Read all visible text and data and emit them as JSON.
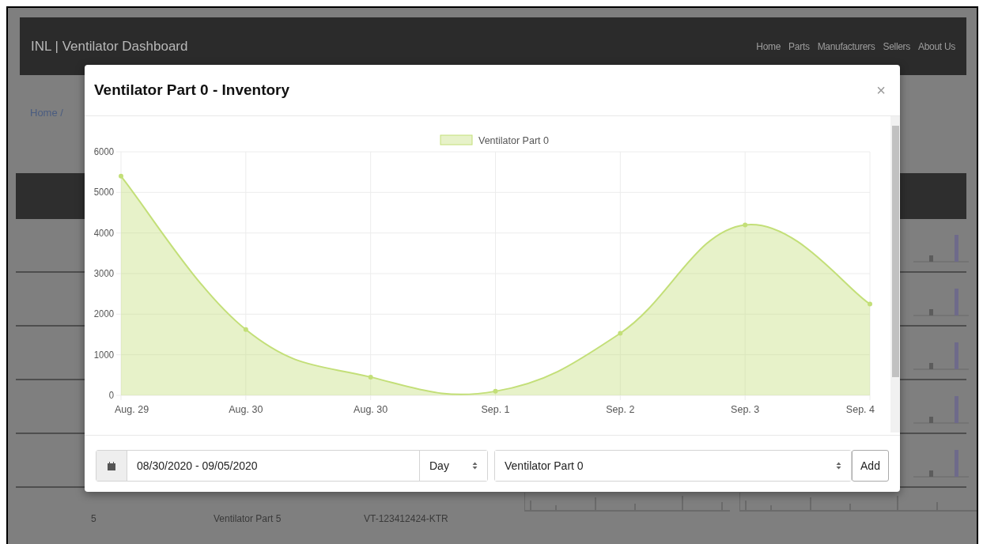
{
  "navbar": {
    "brand": "INL | Ventilator Dashboard",
    "links": [
      "Home",
      "Parts",
      "Manufacturers",
      "Sellers",
      "About Us"
    ]
  },
  "breadcrumb": "Home /",
  "table": {
    "rows": [
      {
        "column_1": "5",
        "column_2": "Ventilator Part 5",
        "column_3": "VT-123412424-KTR"
      }
    ]
  },
  "modal": {
    "title": "Ventilator Part 0 - Inventory",
    "close": "×",
    "chart_data": {
      "type": "area",
      "grid": true,
      "categories": [
        "Aug. 29",
        "Aug. 30",
        "Aug. 30",
        "Sep. 1",
        "Sep. 2",
        "Sep. 3",
        "Sep. 4"
      ],
      "ylim": [
        0,
        6000
      ],
      "yticks": [
        0,
        1000,
        2000,
        3000,
        4000,
        5000,
        6000
      ],
      "series": [
        {
          "name": "Ventilator Part 0",
          "color": "#c3df78",
          "values": [
            5400,
            1620,
            450,
            100,
            1530,
            4200,
            2250
          ]
        }
      ]
    },
    "date_range": "08/30/2020 - 09/05/2020",
    "interval": "Day",
    "part": "Ventilator Part 0",
    "add_button": "Add"
  }
}
